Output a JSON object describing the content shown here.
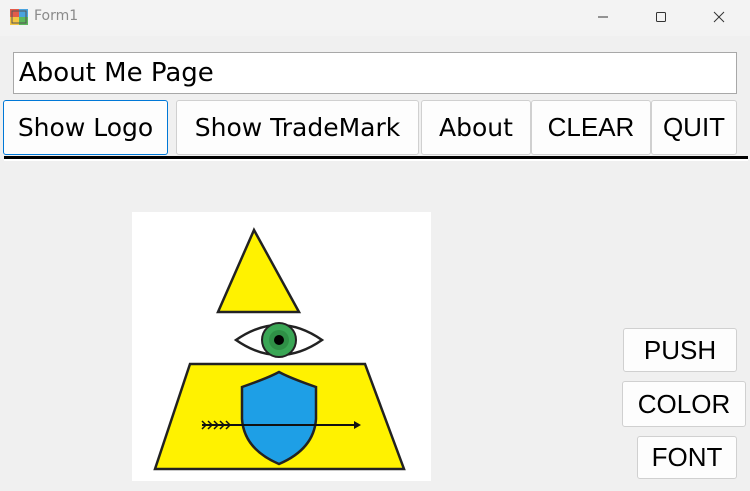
{
  "window": {
    "title": "Form1"
  },
  "header_field": {
    "value": "About Me Page"
  },
  "toolbar": {
    "show_logo": "Show Logo",
    "show_trademark": "Show TradeMark",
    "about": "About",
    "clear": "CLEAR",
    "quit": "QUIT"
  },
  "side_buttons": {
    "push": "PUSH",
    "color": "COLOR",
    "font": "FONT"
  },
  "logo": {
    "colors": {
      "triangle_fill": "#fff200",
      "iris": "#3aa655",
      "shield": "#1e9fe6",
      "outline": "#222222"
    }
  }
}
